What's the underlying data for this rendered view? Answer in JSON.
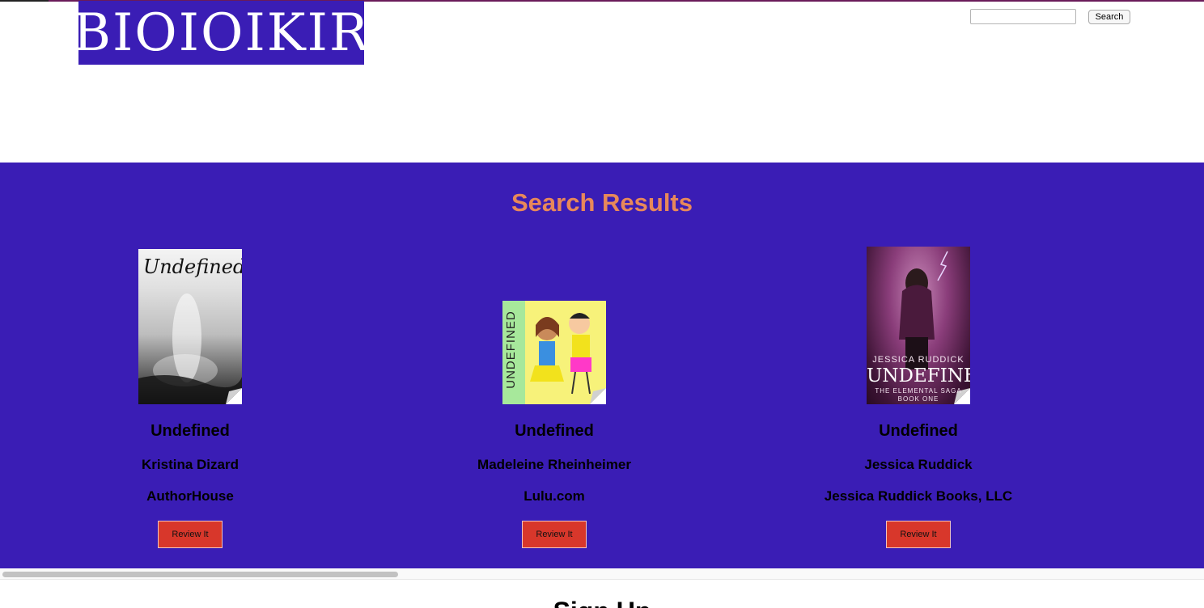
{
  "logo": {
    "text": "BIOIOIKIR",
    "bg_color": "#3a1db5"
  },
  "search": {
    "value": "",
    "placeholder": "",
    "button_label": "Search"
  },
  "results": {
    "title": "Search Results",
    "bg_color": "#3a1db5",
    "title_color": "#e8885a",
    "books": [
      {
        "title": "Undefined",
        "author": "Kristina Dizard",
        "publisher": "AuthorHouse",
        "review_label": "Review It",
        "cover_text": "Undefined"
      },
      {
        "title": "Undefined",
        "author": "Madeleine Rheinheimer",
        "publisher": "Lulu.com",
        "review_label": "Review It",
        "cover_text": "UNDEFINED"
      },
      {
        "title": "Undefined",
        "author": "Jessica Ruddick",
        "publisher": "Jessica Ruddick Books, LLC",
        "review_label": "Review It",
        "cover_text": "UNDEFINED",
        "cover_author": "JESSICA RUDDICK",
        "cover_series": "THE ELEMENTAL SAGA",
        "cover_book": "BOOK ONE"
      }
    ]
  },
  "signup": {
    "title": "Sign Up"
  }
}
